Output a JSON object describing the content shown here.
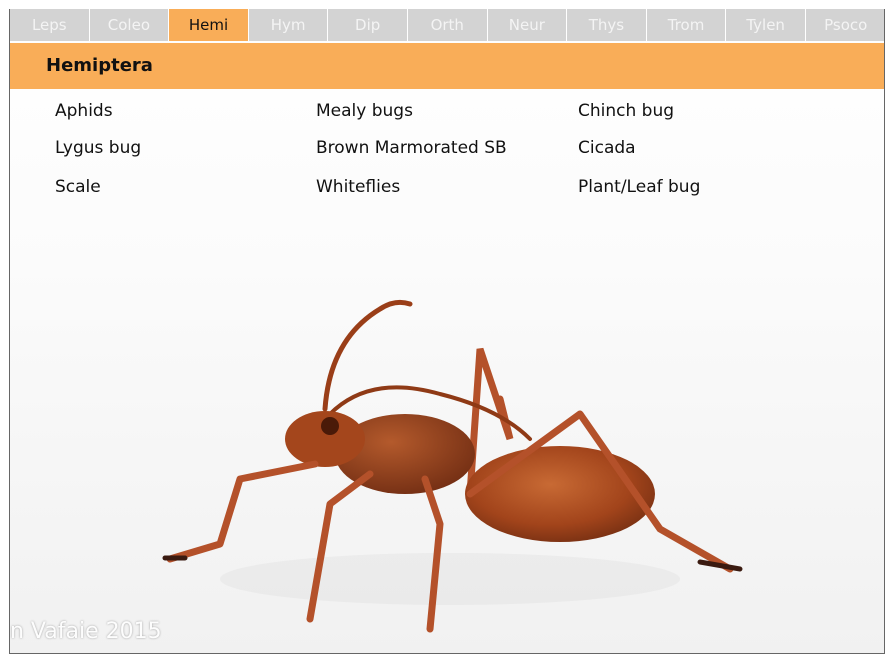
{
  "tabs": [
    {
      "label": "Leps"
    },
    {
      "label": "Coleo"
    },
    {
      "label": "Hemi"
    },
    {
      "label": "Hym"
    },
    {
      "label": "Dip"
    },
    {
      "label": "Orth"
    },
    {
      "label": "Neur"
    },
    {
      "label": "Thys"
    },
    {
      "label": "Trom"
    },
    {
      "label": "Tylen"
    },
    {
      "label": "Psoco"
    }
  ],
  "active_tab": "Hemi",
  "header": {
    "title": "Hemiptera"
  },
  "links": [
    {
      "label": "Aphids"
    },
    {
      "label": "Mealy bugs"
    },
    {
      "label": "Chinch bug"
    },
    {
      "label": "Lygus bug"
    },
    {
      "label": "Brown Marmorated SB"
    },
    {
      "label": "Cicada"
    },
    {
      "label": "Scale"
    },
    {
      "label": "Whiteflies"
    },
    {
      "label": "Plant/Leaf bug"
    }
  ],
  "photo": {
    "watermark": "n Vafaie 2015"
  },
  "colors": {
    "accent": "#f9ad58",
    "tab_bg": "#d3d3d3",
    "insect": "#a8461c"
  }
}
